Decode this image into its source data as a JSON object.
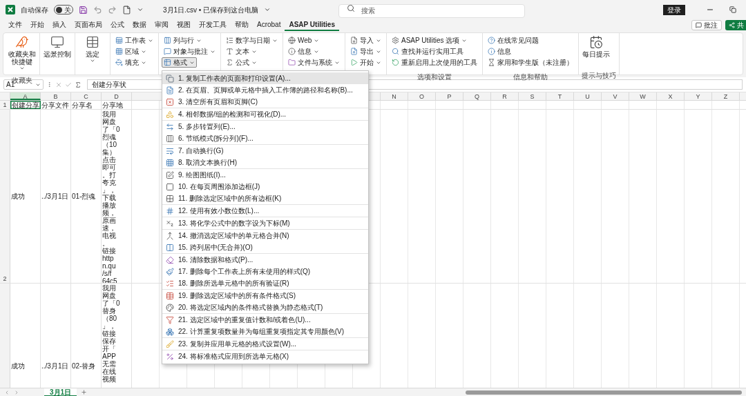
{
  "title_bar": {
    "autosave_label": "自动保存",
    "autosave_on": false,
    "autosave_state": "关",
    "document_title": "3月1日.csv • 已保存到这台电脑",
    "search_placeholder": "搜索",
    "signin": "登录"
  },
  "tabs": [
    {
      "label": "文件",
      "selected": false
    },
    {
      "label": "开始",
      "selected": false
    },
    {
      "label": "插入",
      "selected": false
    },
    {
      "label": "页面布局",
      "selected": false
    },
    {
      "label": "公式",
      "selected": false
    },
    {
      "label": "数据",
      "selected": false
    },
    {
      "label": "审阅",
      "selected": false
    },
    {
      "label": "视图",
      "selected": false
    },
    {
      "label": "开发工具",
      "selected": false
    },
    {
      "label": "帮助",
      "selected": false
    },
    {
      "label": "Acrobat",
      "selected": false
    },
    {
      "label": "ASAP Utilities",
      "selected": true
    }
  ],
  "comments_button": "批注",
  "share_button": "共",
  "ribbon": {
    "groups": [
      {
        "kind": "large",
        "label": "收藏夹",
        "buttons": [
          {
            "label": "收藏夹和快捷键",
            "dropdown": true
          }
        ]
      },
      {
        "kind": "large",
        "buttons": [
          {
            "label": "远景控制",
            "dropdown": false
          }
        ]
      },
      {
        "kind": "large",
        "buttons": [
          {
            "label": "选定",
            "dropdown": true
          }
        ]
      },
      {
        "kind": "stack",
        "buttons": [
          {
            "label": "工作表",
            "dropdown": true,
            "pressed": false
          },
          {
            "label": "区域",
            "dropdown": true,
            "pressed": false
          },
          {
            "label": "填充",
            "dropdown": true,
            "pressed": false
          }
        ]
      },
      {
        "kind": "stack",
        "buttons": [
          {
            "label": "列与行",
            "dropdown": true,
            "pressed": false
          },
          {
            "label": "对象与批注",
            "dropdown": true,
            "pressed": false
          },
          {
            "label": "格式",
            "dropdown": true,
            "pressed": true
          }
        ]
      },
      {
        "kind": "stack",
        "buttons": [
          {
            "label": "数字与日期",
            "dropdown": true,
            "pressed": false
          },
          {
            "label": "文本",
            "dropdown": true,
            "pressed": false
          },
          {
            "label": "公式",
            "dropdown": true,
            "pressed": false
          }
        ]
      },
      {
        "kind": "stack",
        "buttons": [
          {
            "label": "Web",
            "dropdown": true,
            "pressed": false
          },
          {
            "label": "信息",
            "dropdown": true,
            "pressed": false
          },
          {
            "label": "文件与系统",
            "dropdown": true,
            "pressed": false
          }
        ]
      },
      {
        "kind": "stack",
        "buttons": [
          {
            "label": "导入",
            "dropdown": true,
            "pressed": false
          },
          {
            "label": "导出",
            "dropdown": true,
            "pressed": false
          },
          {
            "label": "开始",
            "dropdown": true,
            "pressed": false
          }
        ]
      },
      {
        "kind": "stack",
        "label": "选项和设置",
        "buttons": [
          {
            "label": "ASAP Utilities 选项",
            "dropdown": true,
            "pressed": false
          },
          {
            "label": "查找并运行实用工具",
            "dropdown": false,
            "pressed": false
          },
          {
            "label": "重新启用上次使用的工具",
            "dropdown": false,
            "pressed": false
          }
        ]
      },
      {
        "kind": "stack",
        "label": "信息和帮助",
        "buttons": [
          {
            "label": "在线常见问题",
            "dropdown": false,
            "pressed": false
          },
          {
            "label": "信息",
            "dropdown": false,
            "pressed": false
          },
          {
            "label": "家用和学生版（未注册）",
            "dropdown": false,
            "pressed": false
          }
        ]
      },
      {
        "kind": "large",
        "label": "提示与技巧",
        "buttons": [
          {
            "label": "每日提示",
            "dropdown": false
          }
        ]
      }
    ]
  },
  "format_menu": [
    {
      "label": "1. 复制工作表的页面和打印设置(A)...",
      "selected": true,
      "group_end": false
    },
    {
      "label": "2. 在页眉、页脚或单元格中插入工作簿的路径和名称(B)...",
      "selected": false,
      "group_end": false
    },
    {
      "label": "3. 清空所有页眉和页脚(C)",
      "selected": false,
      "group_end": true
    },
    {
      "label": "4. 相邻数据/组的检测和可视化(D)...",
      "selected": false,
      "group_end": true
    },
    {
      "label": "5. 多步转置列(E)...",
      "selected": false,
      "group_end": false
    },
    {
      "label": "6. 节纸模式(拆分列)(F)...",
      "selected": false,
      "group_end": true
    },
    {
      "label": "7. 自动换行(G)",
      "selected": false,
      "group_end": false
    },
    {
      "label": "8. 取消文本换行(H)",
      "selected": false,
      "group_end": true
    },
    {
      "label": "9. 绘图图纸(I)...",
      "selected": false,
      "group_end": false
    },
    {
      "label": "10. 在每页周围添加边框(J)",
      "selected": false,
      "group_end": false
    },
    {
      "label": "11. 删除选定区域中的所有边框(K)",
      "selected": false,
      "group_end": true
    },
    {
      "label": "12. 使用有效小数位数(L)...",
      "selected": false,
      "group_end": true
    },
    {
      "label": "13. 将化学公式中的数字设为下标(M)",
      "selected": false,
      "group_end": true
    },
    {
      "label": "14. 撤消选定区域中的单元格合并(N)",
      "selected": false,
      "group_end": false
    },
    {
      "label": "15. 跨列居中(无合并)(O)",
      "selected": false,
      "group_end": true
    },
    {
      "label": "16. 清除数据和格式(P)...",
      "selected": false,
      "group_end": false
    },
    {
      "label": "17. 删除每个工作表上所有未使用的样式(Q)",
      "selected": false,
      "group_end": false
    },
    {
      "label": "18. 删除所选单元格中的所有验证(R)",
      "selected": false,
      "group_end": true
    },
    {
      "label": "19. 删除选定区域中的所有条件格式(S)",
      "selected": false,
      "group_end": false
    },
    {
      "label": "20. 将选定区域内的条件格式替换为静态格式(T)",
      "selected": false,
      "group_end": true
    },
    {
      "label": "21. 选定区域中的重复值计数和/或着色(U)...",
      "selected": false,
      "group_end": false
    },
    {
      "label": "22. 计算重复项数量并为每组重复项指定其专用颜色(V)",
      "selected": false,
      "group_end": true
    },
    {
      "label": "23. 复制并应用单元格的格式设置(W)...",
      "selected": false,
      "group_end": true
    },
    {
      "label": "24. 将标准格式应用到所选单元格(X)",
      "selected": false,
      "group_end": false
    }
  ],
  "formula_bar": {
    "name_box": "A1",
    "formula": "创建分享状"
  },
  "sheet": {
    "columns_left": [
      "A",
      "B",
      "C",
      "D"
    ],
    "columns_right": [
      "N",
      "O",
      "P",
      "Q",
      "R",
      "S",
      "T",
      "U",
      "V",
      "W",
      "X",
      "Y",
      "Z"
    ],
    "rows": [
      {
        "header": "1",
        "cells": [
          {
            "text": "创建分享",
            "selected": true
          },
          {
            "text": "分享文件",
            "selected": false
          },
          {
            "text": "分享名",
            "selected": false
          },
          {
            "text": "分享地",
            "selected": false
          }
        ]
      },
      {
        "header": "2",
        "cells": [
          {
            "text": "成功",
            "selected": false
          },
          {
            "text": "../3月1日",
            "selected": false
          },
          {
            "text": "01-烈魂",
            "selected": false
          },
          {
            "lines": [
              "我用",
              "网盘",
              "了「0",
              "烈魂",
              "（10",
              "集）",
              "点击",
              "即可",
              "。打",
              "夸克",
              "」，",
              "下载",
              "播放",
              "频，",
              "原画",
              "速，",
              "电视",
              "。",
              "链接",
              "http",
              "n.qu",
              "/s/f",
              "64c5"
            ],
            "selected": false
          }
        ]
      },
      {
        "cells": [
          {
            "text": "成功",
            "selected": false
          },
          {
            "text": "../3月1日",
            "selected": false
          },
          {
            "text": "02-替身",
            "selected": false
          },
          {
            "lines": [
              "我用",
              "网盘",
              "了「0",
              "替身",
              "（80",
              "」，",
              "链接",
              "保存",
              "开「",
              "APP",
              "无需",
              "在线",
              "视频"
            ],
            "selected": false
          }
        ]
      }
    ]
  },
  "sheet_tabs": [
    {
      "label": "3月1日",
      "selected": true
    }
  ]
}
